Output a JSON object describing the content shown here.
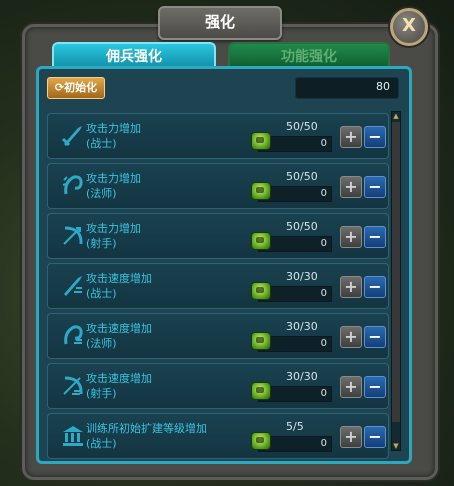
{
  "window": {
    "title": "强化",
    "close_label": "X"
  },
  "tabs": [
    {
      "label": "佣兵强化",
      "active": true
    },
    {
      "label": "功能强化",
      "active": false
    }
  ],
  "toolbar": {
    "reset_label": "初始化",
    "points": "80"
  },
  "rows": [
    {
      "icon": "sword-icon",
      "title": "攻击力增加",
      "sub": "(战士)",
      "level": "50/50",
      "value": "0"
    },
    {
      "icon": "magic-icon",
      "title": "攻击力增加",
      "sub": "(法师)",
      "level": "50/50",
      "value": "0"
    },
    {
      "icon": "bow-icon",
      "title": "攻击力增加",
      "sub": "(射手)",
      "level": "50/50",
      "value": "0"
    },
    {
      "icon": "sword-speed-icon",
      "title": "攻击速度增加",
      "sub": "(战士)",
      "level": "30/30",
      "value": "0"
    },
    {
      "icon": "magic-speed-icon",
      "title": "攻击速度增加",
      "sub": "(法师)",
      "level": "30/30",
      "value": "0"
    },
    {
      "icon": "bow-speed-icon",
      "title": "攻击速度增加",
      "sub": "(射手)",
      "level": "30/30",
      "value": "0"
    },
    {
      "icon": "building-icon",
      "title": "训练所初始扩建等级增加",
      "sub": "(战士)",
      "level": "5/5",
      "value": "0"
    }
  ],
  "buttons": {
    "plus": "+",
    "minus": "−"
  },
  "colors": {
    "accent": "#2bc6e0",
    "label": "#3bc4e0"
  }
}
